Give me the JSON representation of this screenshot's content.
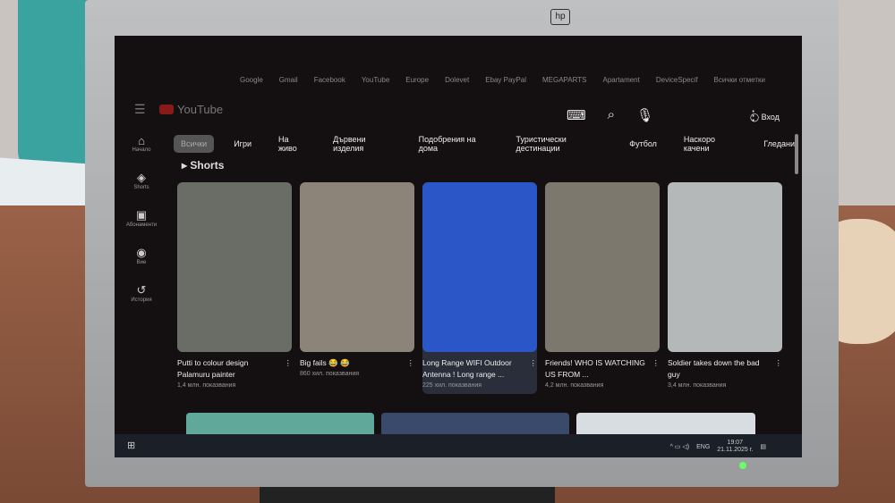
{
  "browser": {
    "bookmarks": [
      "Google",
      "Gmail",
      "Facebook",
      "YouTube",
      "Europe",
      "Dolevet",
      "Ebay PayPal",
      "MEGAPARTS",
      "Apartament",
      "DeviceSpecif",
      "Всички отметки"
    ]
  },
  "header": {
    "logo": "YouTube",
    "login": "Вход"
  },
  "sidebar": [
    {
      "icon": "⌂",
      "label": "Начало"
    },
    {
      "icon": "◈",
      "label": "Shorts"
    },
    {
      "icon": "▣",
      "label": "Абонаменти"
    },
    {
      "icon": "◉",
      "label": "Вие"
    },
    {
      "icon": "↺",
      "label": "История"
    }
  ],
  "chips": [
    "Всички",
    "Игри",
    "На живо",
    "Дървени изделия",
    "Подобрения на дома",
    "Туристически дестинации",
    "Футбол",
    "Наскоро качени",
    "Гледани"
  ],
  "shorts": {
    "title": "Shorts",
    "items": [
      {
        "title": "Putti to colour design Palamuru painter",
        "views": "1,4 млн. показвания",
        "color": "#6a6d66"
      },
      {
        "title": "Big fails 😂 😂",
        "views": "860 хил. показвания",
        "color": "#8c8478"
      },
      {
        "title": "Long Range WIFI Outdoor Antenna ! Long range ...",
        "views": "225 хил. показвания",
        "color": "#2a56c8"
      },
      {
        "title": "Friends! WHO IS WATCHING US FROM ...",
        "views": "4,2 млн. показвания",
        "color": "#7d786d"
      },
      {
        "title": "Soldier takes down the bad guy",
        "views": "3,4 млн. показвания",
        "color": "#b5b8b8"
      }
    ]
  },
  "taskbar": {
    "lang": "ENG",
    "time": "19:07",
    "date": "21.11.2025 г."
  }
}
